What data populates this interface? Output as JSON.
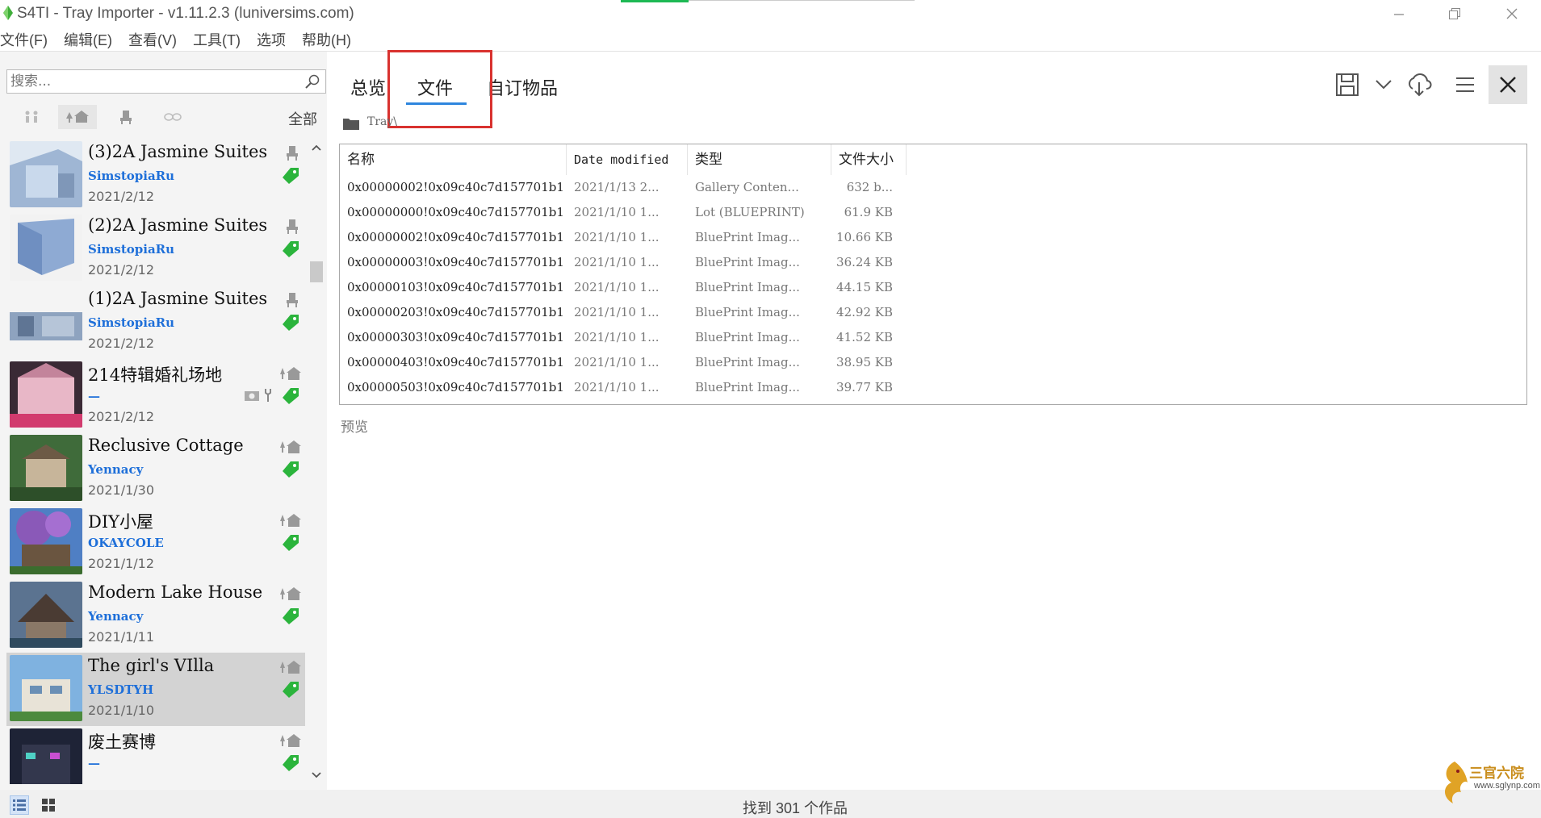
{
  "window": {
    "title": "S4TI - Tray Importer - v1.11.2.3  (luniversims.com)",
    "minimize_icon": "minimize-icon",
    "restore_icon": "restore-icon",
    "close_icon": "close-icon"
  },
  "menu": [
    "文件(F)",
    "编辑(E)",
    "查看(V)",
    "工具(T)",
    "选项",
    "帮助(H)"
  ],
  "sidebar": {
    "search_placeholder": "搜索...",
    "filter_all": "全部",
    "items": [
      {
        "title": "(3)2A Jasmine Suites",
        "creator": "SimstopiaRu",
        "date": "2021/2/12",
        "type": "room",
        "thumb": "blue-room"
      },
      {
        "title": "(2)2A Jasmine Suites",
        "creator": "SimstopiaRu",
        "date": "2021/2/12",
        "type": "room",
        "thumb": "blue-room"
      },
      {
        "title": "(1)2A Jasmine Suites",
        "creator": "SimstopiaRu",
        "date": "2021/2/12",
        "type": "room",
        "thumb": "blue-room"
      },
      {
        "title": "214特辑婚礼场地",
        "creator": "—",
        "date": "2021/2/12",
        "type": "lot",
        "thumb": "pink-wedding"
      },
      {
        "title": "Reclusive Cottage",
        "creator": "Yennacy",
        "date": "2021/1/30",
        "type": "lot",
        "thumb": "green-cottage"
      },
      {
        "title": "DIY小屋",
        "creator": "OKAYCOLE",
        "date": "2021/1/12",
        "type": "lot",
        "thumb": "purple-tree"
      },
      {
        "title": "Modern Lake House",
        "creator": "Yennacy",
        "date": "2021/1/11",
        "type": "lot",
        "thumb": "lake-house"
      },
      {
        "title": "The girl's VIlla",
        "creator": "YLSDTYH",
        "date": "2021/1/10",
        "type": "lot",
        "thumb": "villa"
      },
      {
        "title": "废土赛博",
        "creator": "—",
        "date": "",
        "type": "lot",
        "thumb": "cyber"
      }
    ]
  },
  "tabs": [
    "总览",
    "文件",
    "自订物品"
  ],
  "active_tab": "文件",
  "path": "Tray\\",
  "table": {
    "columns": [
      "名称",
      "Date modified",
      "类型",
      "文件大小"
    ],
    "rows": [
      [
        "0x00000002!0x09c40c7d157701b1",
        "2021/1/13 2...",
        "Gallery Conten...",
        "632 b..."
      ],
      [
        "0x00000000!0x09c40c7d157701b1",
        "2021/1/10 1...",
        "Lot (BLUEPRINT)",
        "61.9 KB"
      ],
      [
        "0x00000002!0x09c40c7d157701b1",
        "2021/1/10 1...",
        "BluePrint Imag...",
        "10.66 KB"
      ],
      [
        "0x00000003!0x09c40c7d157701b1",
        "2021/1/10 1...",
        "BluePrint Imag...",
        "36.24 KB"
      ],
      [
        "0x00000103!0x09c40c7d157701b1",
        "2021/1/10 1...",
        "BluePrint Imag...",
        "44.15 KB"
      ],
      [
        "0x00000203!0x09c40c7d157701b1",
        "2021/1/10 1...",
        "BluePrint Imag...",
        "42.92 KB"
      ],
      [
        "0x00000303!0x09c40c7d157701b1",
        "2021/1/10 1...",
        "BluePrint Imag...",
        "41.52 KB"
      ],
      [
        "0x00000403!0x09c40c7d157701b1",
        "2021/1/10 1...",
        "BluePrint Imag...",
        "38.95 KB"
      ],
      [
        "0x00000503!0x09c40c7d157701b1",
        "2021/1/10 1...",
        "BluePrint Imag...",
        "39.77 KB"
      ]
    ]
  },
  "preview_label": "预览",
  "status": "找到 301 个作品",
  "watermark": {
    "text": "三官六院",
    "url": "www.sglynp.com"
  },
  "colors": {
    "accent": "#2e86de",
    "highlight": "#d9322f",
    "creator": "#1e6fd9",
    "tag": "#2bb43c"
  }
}
